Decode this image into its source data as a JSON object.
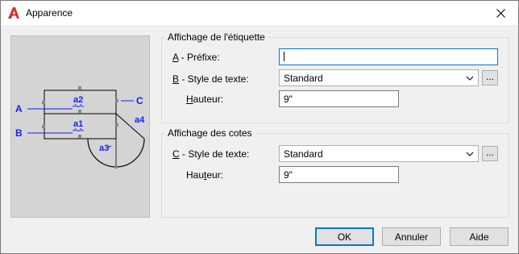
{
  "window": {
    "title": "Apparence",
    "colors": {
      "accent": "#0078d7",
      "app_icon": "#d32f2f",
      "preview_bg": "#d4d4d4",
      "diagram_blue": "#1a1aff"
    }
  },
  "preview": {
    "labels": {
      "a": "A",
      "b": "B",
      "c": "C",
      "a1": "a1",
      "a2": "a2",
      "a3": "a3",
      "a4": "a4"
    }
  },
  "label_group": {
    "title": "Affichage de l'étiquette",
    "prefix": {
      "key": "A",
      "rest": " - Préfixe:",
      "value": ""
    },
    "text_style": {
      "key": "B",
      "rest": " - Style de texte:",
      "value": "Standard"
    },
    "height": {
      "pre": "",
      "key": "H",
      "rest": "auteur:",
      "value": "9\""
    }
  },
  "dims_group": {
    "title": "Affichage des cotes",
    "text_style": {
      "key": "C",
      "rest": " - Style de texte:",
      "value": "Standard"
    },
    "height": {
      "pre": "Hau",
      "key": "t",
      "rest": "eur:",
      "value": "9\""
    }
  },
  "ellipsis": "...",
  "buttons": {
    "ok": "OK",
    "cancel": "Annuler",
    "help": "Aide"
  }
}
